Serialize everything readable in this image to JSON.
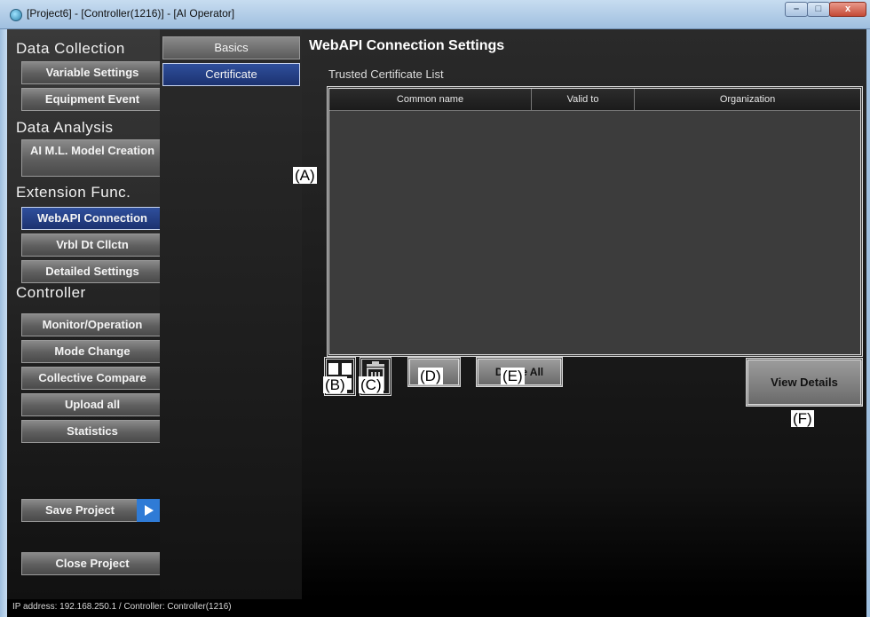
{
  "window": {
    "title": "[Project6] - [Controller(1216)] - [AI Operator]",
    "close_glyph": "x"
  },
  "sidebar": {
    "sections": [
      {
        "label": "Data Collection",
        "items": [
          "Variable Settings",
          "Equipment Event"
        ]
      },
      {
        "label": "Data Analysis",
        "items": [
          "AI M.L. Model Creation"
        ]
      },
      {
        "label": "Extension Func.",
        "items": [
          "WebAPI Connection",
          "Vrbl Dt Cllctn",
          "Detailed Settings"
        ]
      },
      {
        "label": "Controller",
        "items": [
          "Monitor/Operation",
          "Mode Change",
          "Collective Compare",
          "Upload all",
          "Statistics"
        ]
      }
    ],
    "active_item": "WebAPI Connection",
    "save_project": "Save Project",
    "close_project": "Close Project"
  },
  "subtabs": {
    "items": [
      "Basics",
      "Certificate"
    ],
    "active": "Certificate"
  },
  "main": {
    "title": "WebAPI Connection Settings",
    "list_label": "Trusted Certificate List",
    "columns": [
      "Common name",
      "Valid to",
      "Organization"
    ],
    "rows": [],
    "buttons": {
      "get": "Get",
      "delete_all": "Delete All",
      "view_details": "View Details"
    }
  },
  "callouts": {
    "a": "(A)",
    "b": "(B)",
    "c": "(C)",
    "d": "(D)",
    "e": "(E)",
    "f": "(F)"
  },
  "status": {
    "text": "IP address: 192.168.250.1 / Controller: Controller(1216)"
  },
  "icons": {
    "add": "plus-icon",
    "delete": "trash-icon",
    "arrow": "play-arrow-icon"
  },
  "colors": {
    "active_blue": "#1c3270",
    "accent_arrow": "#2f7bd6"
  }
}
